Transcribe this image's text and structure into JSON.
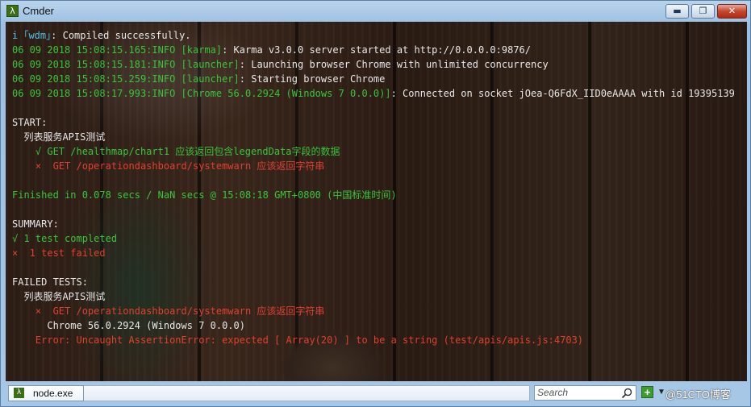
{
  "window": {
    "title": "Cmder",
    "app_icon": "λ",
    "controls": {
      "minimize": "▬",
      "maximize": "❐",
      "close": "✕"
    }
  },
  "colors": {
    "cyan": "#4fc1e9",
    "green": "#39c43b",
    "red": "#e0402f",
    "white": "#e8e8e8"
  },
  "terminal": {
    "lines": [
      {
        "segments": [
          {
            "text": "i ",
            "color": "cyan"
          },
          {
            "text": "｢wdm｣",
            "color": "cyan"
          },
          {
            "text": ": Compiled successfully.",
            "color": "white"
          }
        ]
      },
      {
        "segments": [
          {
            "text": "06 09 2018 15:08:15.165:INFO [karma]",
            "color": "green"
          },
          {
            "text": ": Karma v3.0.0 server started at http://0.0.0.0:9876/",
            "color": "white"
          }
        ]
      },
      {
        "segments": [
          {
            "text": "06 09 2018 15:08:15.181:INFO [launcher]",
            "color": "green"
          },
          {
            "text": ": Launching browser Chrome with unlimited concurrency",
            "color": "white"
          }
        ]
      },
      {
        "segments": [
          {
            "text": "06 09 2018 15:08:15.259:INFO [launcher]",
            "color": "green"
          },
          {
            "text": ": Starting browser Chrome",
            "color": "white"
          }
        ]
      },
      {
        "segments": [
          {
            "text": "06 09 2018 15:08:17.993:INFO [Chrome 56.0.2924 (Windows 7 0.0.0)]",
            "color": "green"
          },
          {
            "text": ": Connected on socket jOea-Q6FdX_IID0eAAAA with id 19395139",
            "color": "white"
          }
        ]
      },
      {
        "segments": []
      },
      {
        "segments": [
          {
            "text": "START:",
            "color": "white"
          }
        ]
      },
      {
        "segments": [
          {
            "text": "  列表服务APIS测试",
            "color": "white"
          }
        ]
      },
      {
        "segments": [
          {
            "text": "    √ GET /healthmap/chart1 应该返回包含legendData字段的数据",
            "color": "green"
          }
        ]
      },
      {
        "segments": [
          {
            "text": "    ×  GET /operationdashboard/systemwarn 应该返回字符串",
            "color": "red"
          }
        ]
      },
      {
        "segments": []
      },
      {
        "segments": [
          {
            "text": "Finished in 0.078 secs / NaN secs @ 15:08:18 GMT+0800 (中国标准时间)",
            "color": "green"
          }
        ]
      },
      {
        "segments": []
      },
      {
        "segments": [
          {
            "text": "SUMMARY:",
            "color": "white"
          }
        ]
      },
      {
        "segments": [
          {
            "text": "√ 1 test completed",
            "color": "green"
          }
        ]
      },
      {
        "segments": [
          {
            "text": "×  1 test failed",
            "color": "red"
          }
        ]
      },
      {
        "segments": []
      },
      {
        "segments": [
          {
            "text": "FAILED TESTS:",
            "color": "white"
          }
        ]
      },
      {
        "segments": [
          {
            "text": "  列表服务APIS测试",
            "color": "white"
          }
        ]
      },
      {
        "segments": [
          {
            "text": "    ×  GET /operationdashboard/systemwarn 应该返回字符串",
            "color": "red"
          }
        ]
      },
      {
        "segments": [
          {
            "text": "      Chrome 56.0.2924 (Windows 7 0.0.0)",
            "color": "white"
          }
        ]
      },
      {
        "segments": [
          {
            "text": "    Error: Uncaught AssertionError: expected [ Array(20) ] to be a string (test/apis/apis.js:4703)",
            "color": "red"
          }
        ]
      }
    ]
  },
  "tabs": [
    {
      "label": "node.exe",
      "icon": "λ"
    }
  ],
  "search": {
    "placeholder": "Search",
    "icon": "search-icon"
  },
  "toolbar": {
    "add_label": "+",
    "dropdown_label": "▼"
  },
  "watermark": "@51CTO博客"
}
